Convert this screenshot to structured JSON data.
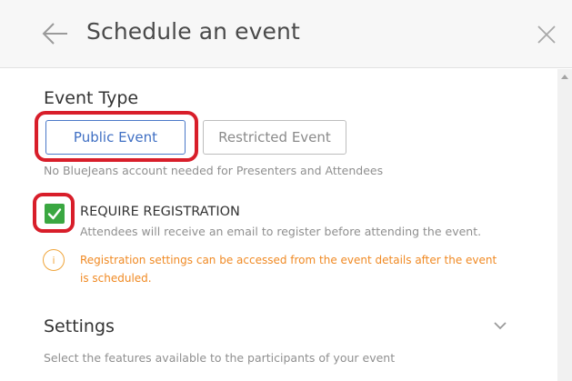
{
  "header": {
    "title": "Schedule an event",
    "back_icon": "arrow-left-icon",
    "close_icon": "close-icon"
  },
  "event_type": {
    "heading": "Event Type",
    "public_label": "Public Event",
    "restricted_label": "Restricted Event",
    "selected": "Public Event",
    "description": "No BlueJeans account needed for Presenters and Attendees"
  },
  "registration": {
    "checked": true,
    "label": "REQUIRE REGISTRATION",
    "description": "Attendees will receive an email to register before attending the event.",
    "info_icon": "info-icon",
    "notice": "Registration settings can be accessed from the event details after the event is scheduled."
  },
  "settings": {
    "heading": "Settings",
    "description": "Select the features available to the participants of your event",
    "expand_icon": "chevron-down-icon"
  },
  "colors": {
    "highlight_ring": "#d81e2a",
    "primary_blue": "#3f6fc3",
    "check_green": "#3aa741",
    "notice_orange": "#f08a24"
  }
}
